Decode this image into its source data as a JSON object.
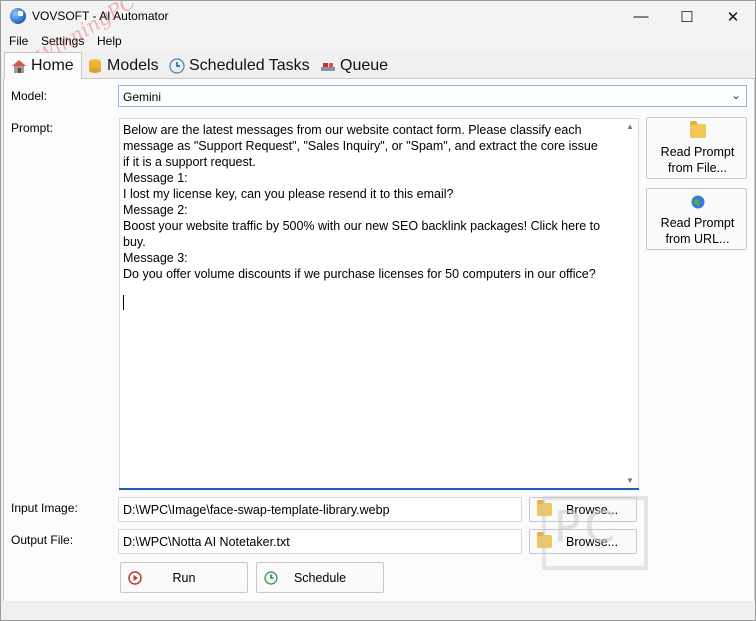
{
  "window": {
    "title": "VOVSOFT - AI Automator"
  },
  "menu": [
    "File",
    "Settings",
    "Help"
  ],
  "tabs": [
    {
      "label": "Home",
      "icon": "home-icon",
      "active": true
    },
    {
      "label": "Models",
      "icon": "database-icon",
      "active": false
    },
    {
      "label": "Scheduled Tasks",
      "icon": "clock-icon",
      "active": false
    },
    {
      "label": "Queue",
      "icon": "queue-icon",
      "active": false
    }
  ],
  "form": {
    "model_label": "Model:",
    "model_value": "Gemini",
    "prompt_label": "Prompt:",
    "prompt_lines": [
      "Below are the latest messages from our website contact form. Please classify each",
      "message as \"Support Request\", \"Sales Inquiry\", or \"Spam\", and extract the core issue",
      "if it is a support request.",
      "Message 1:",
      "I lost my license key, can you please resend it to this email?",
      "Message 2:",
      "Boost your website traffic by 500% with our new SEO backlink packages! Click here to",
      "buy.",
      "Message 3:",
      "Do you offer volume discounts if we purchase licenses for 50 computers in our office?"
    ],
    "read_file_label_1": "Read Prompt",
    "read_file_label_2": "from File...",
    "read_url_label_1": "Read Prompt",
    "read_url_label_2": "from URL...",
    "input_image_label": "Input Image:",
    "input_image_value": "D:\\WPC\\Image\\face-swap-template-library.webp",
    "output_file_label": "Output File:",
    "output_file_value": "D:\\WPC\\Notta AI Notetaker.txt",
    "browse_label": "Browse...",
    "run_label": "Run",
    "schedule_label": "Schedule"
  },
  "watermark": {
    "text": "WinningPC",
    "box_text": "PC"
  },
  "colors": {
    "accent": "#1f5fb5",
    "combo_border": "#8fb8e3"
  }
}
